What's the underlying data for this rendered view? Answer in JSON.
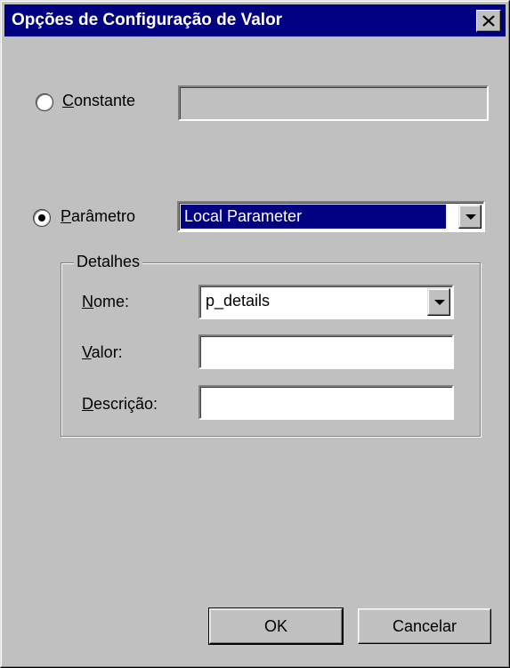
{
  "dialog": {
    "title": "Opções de Configuração de Valor",
    "close_icon": "close-x-icon"
  },
  "constante": {
    "label_first": "C",
    "label_rest": "onstante",
    "selected": false,
    "value": ""
  },
  "parametro": {
    "label_first": "P",
    "label_rest": "arâmetro",
    "selected": true,
    "selected_option": "Local Parameter"
  },
  "details": {
    "title": "Detalhes",
    "nome_label_first": "N",
    "nome_label_rest": "ome:",
    "nome_value": "p_details",
    "valor_label_first": "V",
    "valor_label_rest": "alor:",
    "valor_value": "",
    "descricao_label_first": "D",
    "descricao_label_rest": "escrição:",
    "descricao_value": ""
  },
  "buttons": {
    "ok": "OK",
    "cancel": "Cancelar"
  },
  "colors": {
    "titlebar": "#000080",
    "face": "#c0c0c0",
    "highlight_selection": "#000080"
  }
}
